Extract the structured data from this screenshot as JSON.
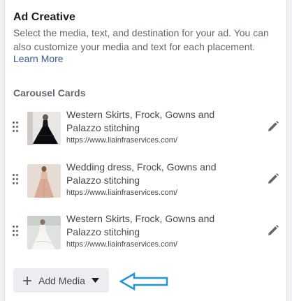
{
  "panel": {
    "title": "Ad Creative",
    "description": "Select the media, text, and destination for your ad. You can also customize your media and text for each placement.",
    "learn_more": "Learn More",
    "carousel_label": "Carousel Cards"
  },
  "cards": [
    {
      "title": "Western Skirts, Frock, Gowns and Palazzo stitching",
      "url": "https://www.liainfraservices.com/"
    },
    {
      "title": "Wedding dress, Frock, Gowns and Palazzo stitching",
      "url": "https://www.liainfraservices.com/"
    },
    {
      "title": "Western Skirts, Frock, Gowns and Palazzo stitching",
      "url": "https://www.liainfraservices.com/"
    }
  ],
  "add_media": {
    "label": "Add Media",
    "icon": "plus-icon",
    "dropdown_icon": "caret-down-icon"
  },
  "annotation": {
    "icon": "left-arrow-outline",
    "color": "#1e96e0"
  },
  "colors": {
    "link": "#385898",
    "button_bg": "#ebedf0",
    "page_bg": "#f0f2f5"
  }
}
